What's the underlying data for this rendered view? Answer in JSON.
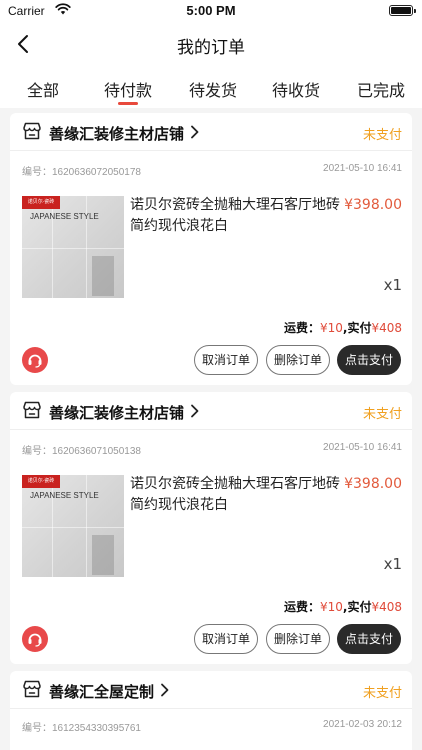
{
  "status_bar": {
    "carrier": "Carrier",
    "time": "5:00 PM"
  },
  "nav": {
    "title": "我的订单"
  },
  "tabs": [
    {
      "label": "全部"
    },
    {
      "label": "待付款"
    },
    {
      "label": "待发货"
    },
    {
      "label": "待收货"
    },
    {
      "label": "已完成"
    }
  ],
  "active_tab": "待付款",
  "colors": {
    "accent": "#e8493c",
    "status": "#f0a020",
    "price": "#e25a3c",
    "primary_button": "#2a2a2a"
  },
  "orders": [
    {
      "shop_name": "善缘汇装修主材店铺",
      "status": "未支付",
      "order_no": "编号：1620636072050178",
      "order_time": "2021-05-10 16:41",
      "product": {
        "title": "诺贝尔瓷砖全抛釉大理石客厅地砖简约现代浪花白",
        "price": "¥398.00",
        "qty": "x1",
        "image_text": "JAPANESE STYLE",
        "image_logo": "诺贝尔·瓷砖"
      },
      "summary": {
        "freight_label": "运费：",
        "freight": "¥10",
        "paid_label": ",实付",
        "paid": "¥408"
      },
      "buttons": {
        "cancel": "取消订单",
        "delete": "删除订单",
        "pay": "点击支付"
      }
    },
    {
      "shop_name": "善缘汇装修主材店铺",
      "status": "未支付",
      "order_no": "编号：1620636071050138",
      "order_time": "2021-05-10 16:41",
      "product": {
        "title": "诺贝尔瓷砖全抛釉大理石客厅地砖简约现代浪花白",
        "price": "¥398.00",
        "qty": "x1",
        "image_text": "JAPANESE STYLE",
        "image_logo": "诺贝尔·瓷砖"
      },
      "summary": {
        "freight_label": "运费：",
        "freight": "¥10",
        "paid_label": ",实付",
        "paid": "¥408"
      },
      "buttons": {
        "cancel": "取消订单",
        "delete": "删除订单",
        "pay": "点击支付"
      }
    },
    {
      "shop_name": "善缘汇全屋定制",
      "status": "未支付",
      "order_no": "编号：1612354330395761",
      "order_time": "2021-02-03 20:12"
    }
  ]
}
